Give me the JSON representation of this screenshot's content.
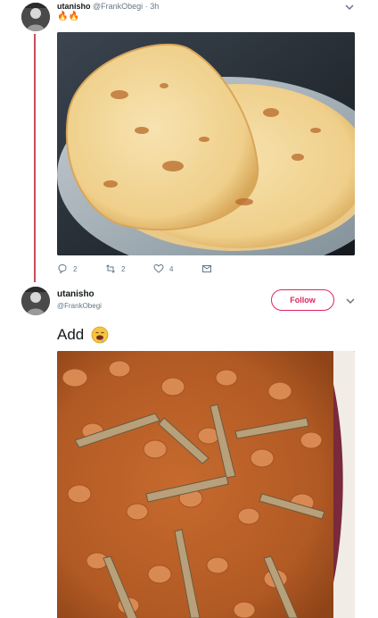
{
  "tweet1": {
    "name": "utanisho",
    "handle": "@FrankObegi",
    "separator": "·",
    "time": "3h",
    "text": "🔥🔥",
    "image": "chapati-plate",
    "counts": {
      "replies": "2",
      "retweets": "2",
      "likes": "4"
    },
    "icons": [
      "reply-icon",
      "retweet-icon",
      "like-icon",
      "direct-message-icon"
    ]
  },
  "tweet2": {
    "name": "utanisho",
    "handle": "@FrankObegi",
    "follow_label": "Follow",
    "text": "Add",
    "emoji": "drooling-face-emoji",
    "image": "beans-and-fish-stew"
  },
  "colors": {
    "accent": "#e0245e",
    "thread_line": "#cc4d5a",
    "muted": "#657786",
    "text": "#14171a"
  }
}
